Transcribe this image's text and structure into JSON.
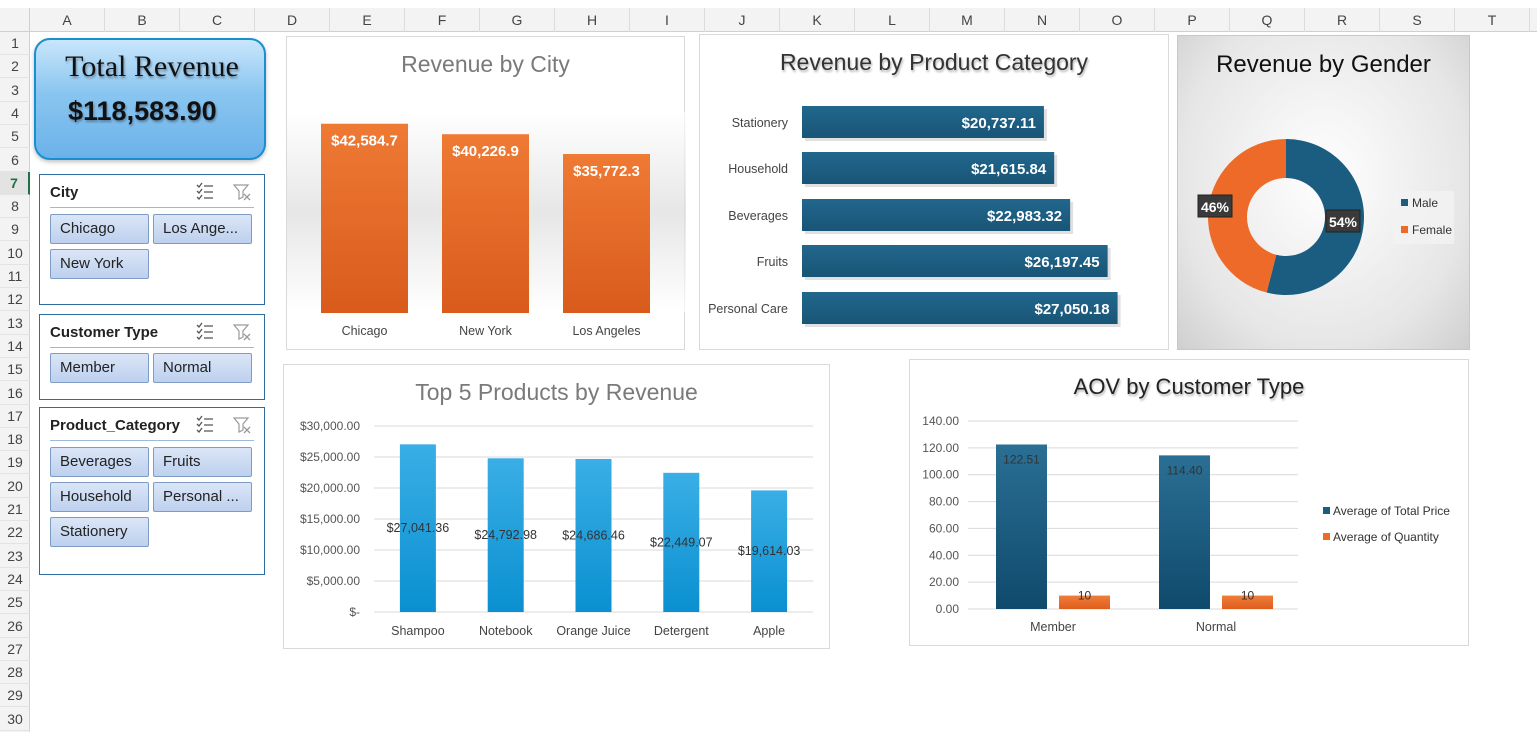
{
  "columns": [
    "A",
    "B",
    "C",
    "D",
    "E",
    "F",
    "G",
    "H",
    "I",
    "J",
    "K",
    "L",
    "M",
    "N",
    "O",
    "P",
    "Q",
    "R",
    "S",
    "T"
  ],
  "rows": [
    "1",
    "2",
    "3",
    "4",
    "5",
    "6",
    "7",
    "8",
    "9",
    "10",
    "11",
    "12",
    "13",
    "14",
    "15",
    "16",
    "17",
    "18",
    "19",
    "20",
    "21",
    "22",
    "23",
    "24",
    "25",
    "26",
    "27",
    "28",
    "29",
    "30"
  ],
  "active_row": "7",
  "kpi": {
    "title": "Total Revenue",
    "value": "$118,583.90"
  },
  "slicers": {
    "city": {
      "title": "City",
      "items": [
        "Chicago",
        "Los Ange...",
        "New York"
      ]
    },
    "customer_type": {
      "title": "Customer Type",
      "items": [
        "Member",
        "Normal"
      ]
    },
    "product_category": {
      "title": "Product_Category",
      "items": [
        "Beverages",
        "Fruits",
        "Household",
        "Personal ...",
        "Stationery"
      ]
    }
  },
  "colors": {
    "orange": "#e26b24",
    "navy": "#1b5d80",
    "blue": "#1a9ad8",
    "accent_orange": "#ee6a28"
  },
  "chart_data": [
    {
      "id": "city",
      "type": "bar",
      "title": "Revenue by City",
      "categories": [
        "Chicago",
        "New York",
        "Los Angeles"
      ],
      "values": [
        42584.7,
        40226.9,
        35772.3
      ],
      "labels": [
        "$42,584.7",
        "$40,226.9",
        "$35,772.3"
      ]
    },
    {
      "id": "category",
      "type": "bar",
      "orientation": "horizontal",
      "title": "Revenue by Product Category",
      "categories": [
        "Stationery",
        "Household",
        "Beverages",
        "Fruits",
        "Personal Care"
      ],
      "values": [
        20737.11,
        21615.84,
        22983.32,
        26197.45,
        27050.18
      ],
      "labels": [
        "$20,737.11",
        "$21,615.84",
        "$22,983.32",
        "$26,197.45",
        "$27,050.18"
      ]
    },
    {
      "id": "gender",
      "type": "pie",
      "title": "Revenue by Gender",
      "categories": [
        "Male",
        "Female"
      ],
      "values": [
        54,
        46
      ],
      "labels": [
        "54%",
        "46%"
      ],
      "legend": [
        "Male",
        "Female"
      ]
    },
    {
      "id": "top5",
      "type": "bar",
      "title": "Top 5 Products by Revenue",
      "categories": [
        "Shampoo",
        "Notebook",
        "Orange Juice",
        "Detergent",
        "Apple"
      ],
      "values": [
        27041.36,
        24792.98,
        24686.46,
        22449.07,
        19614.03
      ],
      "labels": [
        "$27,041.36",
        "$24,792.98",
        "$24,686.46",
        "$22,449.07",
        "$19,614.03"
      ],
      "ylim": [
        0,
        30000
      ],
      "yticks": [
        "$-",
        "$5,000.00",
        "$10,000.00",
        "$15,000.00",
        "$20,000.00",
        "$25,000.00",
        "$30,000.00"
      ]
    },
    {
      "id": "aov",
      "type": "bar",
      "title": "AOV by Customer Type",
      "categories": [
        "Member",
        "Normal"
      ],
      "series": [
        {
          "name": "Average of Total Price",
          "values": [
            122.51,
            114.4
          ],
          "labels": [
            "122.51",
            "114.40"
          ]
        },
        {
          "name": "Average of Quantity",
          "values": [
            10,
            10
          ],
          "labels": [
            "10",
            "10"
          ]
        }
      ],
      "ylim": [
        0,
        140
      ],
      "yticks": [
        "0.00",
        "20.00",
        "40.00",
        "60.00",
        "80.00",
        "100.00",
        "120.00",
        "140.00"
      ]
    }
  ]
}
